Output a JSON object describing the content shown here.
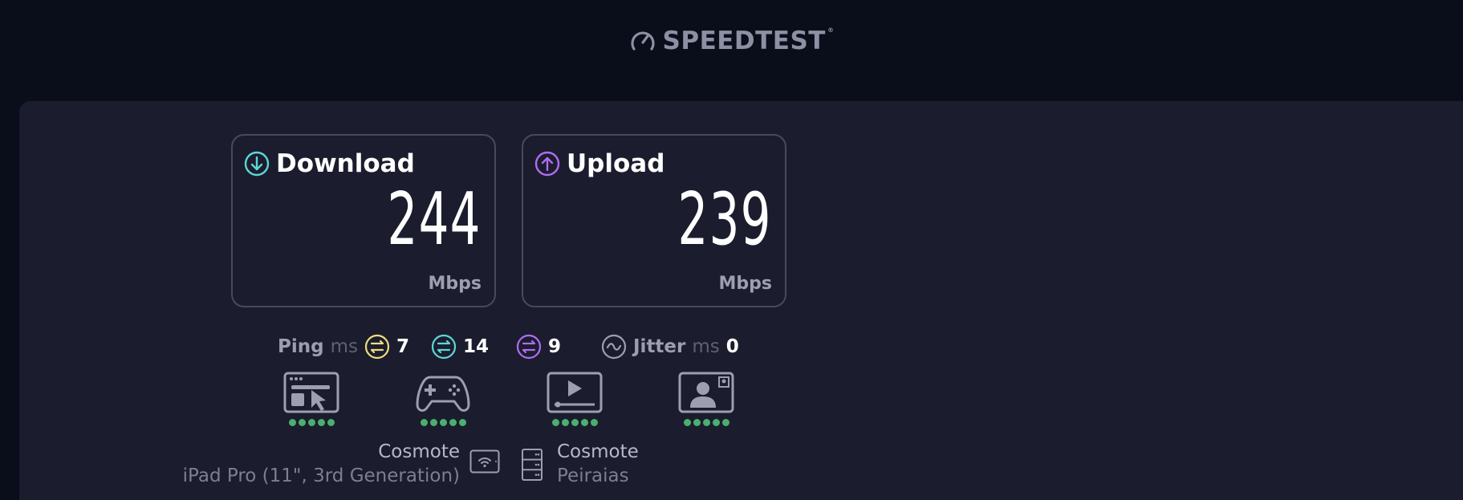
{
  "header": {
    "logo_text": "SPEEDTEST",
    "logo_icon": "gauge-icon",
    "trademark": "®"
  },
  "download": {
    "label": "Download",
    "value": "244",
    "unit": "Mbps",
    "icon": "arrow-down-circle-icon",
    "accent": "#5dd6d6"
  },
  "upload": {
    "label": "Upload",
    "value": "239",
    "unit": "Mbps",
    "icon": "arrow-up-circle-icon",
    "accent": "#b06cf0"
  },
  "ping": {
    "label": "Ping",
    "unit": "ms",
    "idle": "7",
    "download": "14",
    "upload": "9",
    "idle_color": "#f0dd7a",
    "download_color": "#5dd6d6",
    "upload_color": "#b06cf0"
  },
  "jitter": {
    "label": "Jitter",
    "unit": "ms",
    "value": "0"
  },
  "apps": [
    {
      "icon": "web-browsing-icon",
      "rating": 5
    },
    {
      "icon": "gaming-controller-icon",
      "rating": 5
    },
    {
      "icon": "video-streaming-icon",
      "rating": 5
    },
    {
      "icon": "video-call-icon",
      "rating": 5
    }
  ],
  "connection": {
    "client_isp": "Cosmote",
    "client_device": "iPad Pro (11\", 3rd Generation)",
    "server_isp": "Cosmote",
    "server_location": "Peiraias"
  },
  "colors": {
    "rating_dot": "#4caf6e",
    "background": "#0a0d1a",
    "panel": "#1b1d2e"
  }
}
